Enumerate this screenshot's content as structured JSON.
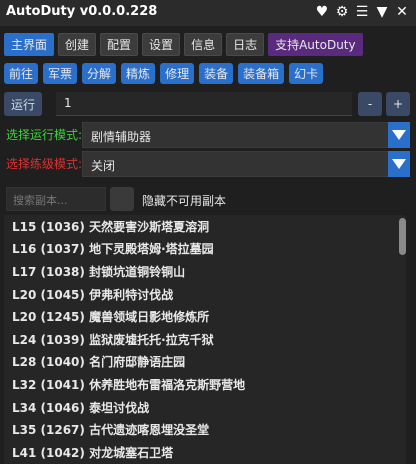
{
  "app": {
    "title": "AutoDuty v0.0.0.228"
  },
  "titlebar_icons": [
    {
      "name": "heart-icon",
      "glyph": "♥"
    },
    {
      "name": "gear-icon",
      "glyph": "⚙"
    },
    {
      "name": "menu-icon",
      "glyph": "☰"
    },
    {
      "name": "collapse-icon",
      "glyph": "▼"
    },
    {
      "name": "close-icon",
      "glyph": "✕"
    }
  ],
  "tabs": [
    {
      "label": "主界面",
      "state": "active"
    },
    {
      "label": "创建",
      "state": ""
    },
    {
      "label": "配置",
      "state": ""
    },
    {
      "label": "设置",
      "state": ""
    },
    {
      "label": "信息",
      "state": ""
    },
    {
      "label": "日志",
      "state": ""
    },
    {
      "label": "支持AutoDuty",
      "state": "special"
    }
  ],
  "subtabs": [
    "前往",
    "军票",
    "分解",
    "精炼",
    "修理",
    "装备",
    "装备箱",
    "幻卡"
  ],
  "run": {
    "button_label": "运行",
    "value": "1",
    "minus_label": "-",
    "plus_label": "+"
  },
  "mode": {
    "label": "选择运行模式:",
    "label_color": "#3cd43c",
    "selected": "剧情辅助器"
  },
  "level_mode": {
    "label": "选择练级模式:",
    "label_color": "#e03030",
    "selected": "关闭"
  },
  "search": {
    "placeholder": "搜索副本...",
    "hide_label": "隐藏不可用副本"
  },
  "dungeons": [
    "L15 (1036) 天然要害沙斯塔夏溶洞",
    "L16 (1037) 地下灵殿塔姆·塔拉墓园",
    "L17 (1038) 封锁坑道铜铃铜山",
    "L20 (1045) 伊弗利特讨伐战",
    "L20 (1245) 魔兽领域日影地修炼所",
    "L24 (1039) 监狱废墟托托·拉克千狱",
    "L28 (1040) 名门府邸静语庄园",
    "L32 (1041) 休养胜地布雷福洛克斯野营地",
    "L34 (1046) 泰坦讨伐战",
    "L35 (1267) 古代遗迹喀恩埋没圣堂",
    "L41 (1042) 对龙城塞石卫塔"
  ]
}
